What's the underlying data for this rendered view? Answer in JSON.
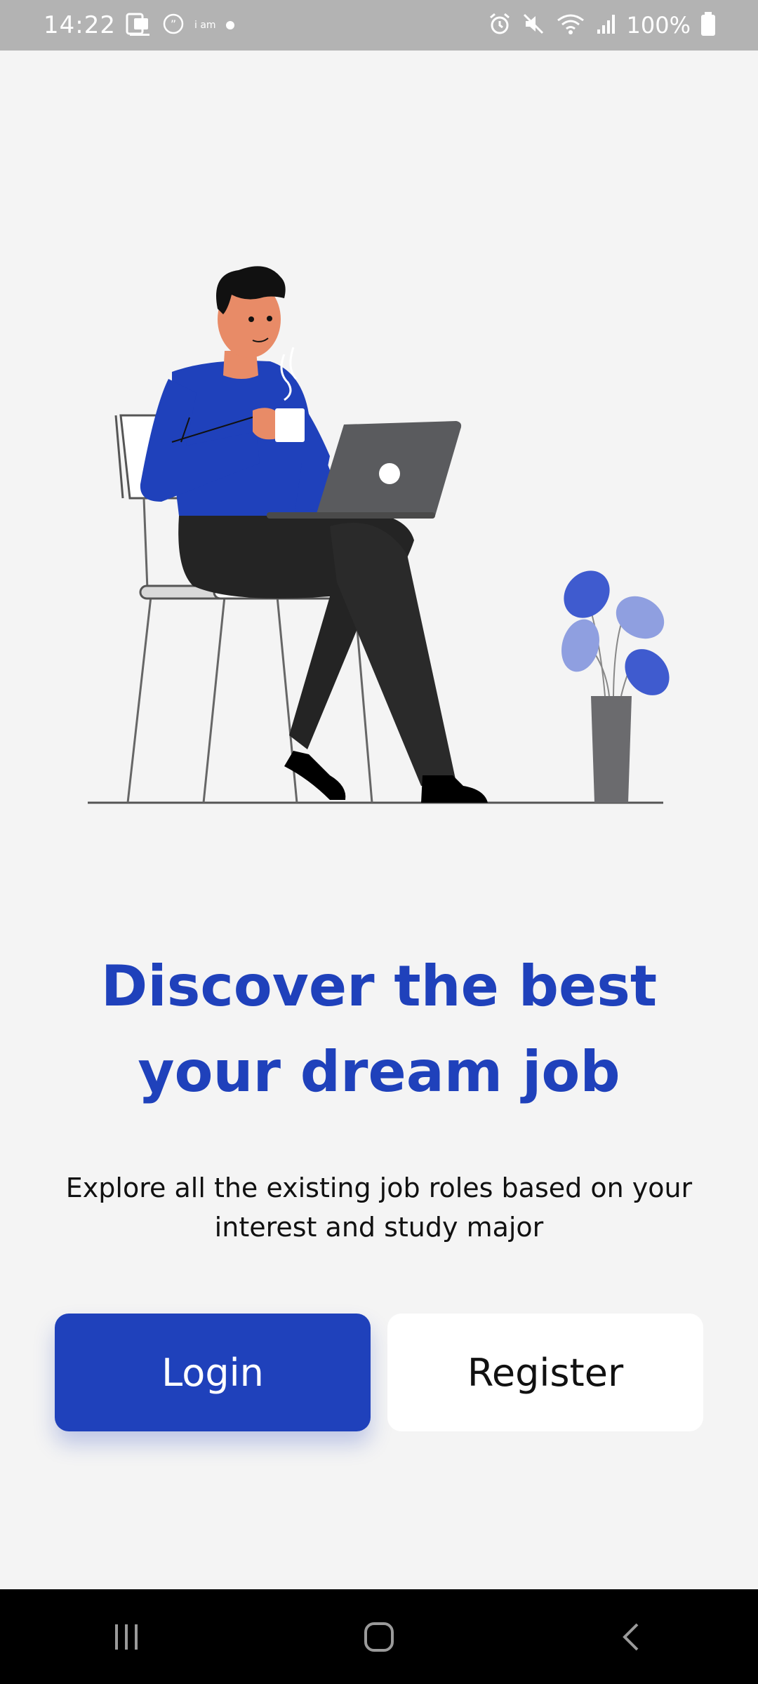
{
  "status_bar": {
    "time": "14:22",
    "small_label": "i am",
    "battery": "100%"
  },
  "onboarding": {
    "headline_line1": "Discover the best",
    "headline_line2": "your dream job",
    "subtitle": "Explore all the existing job roles based on your interest and study major"
  },
  "buttons": {
    "login": "Login",
    "register": "Register"
  },
  "colors": {
    "brand": "#1f41bb",
    "background": "#f4f4f4",
    "status_bar": "#b3b3b3"
  }
}
